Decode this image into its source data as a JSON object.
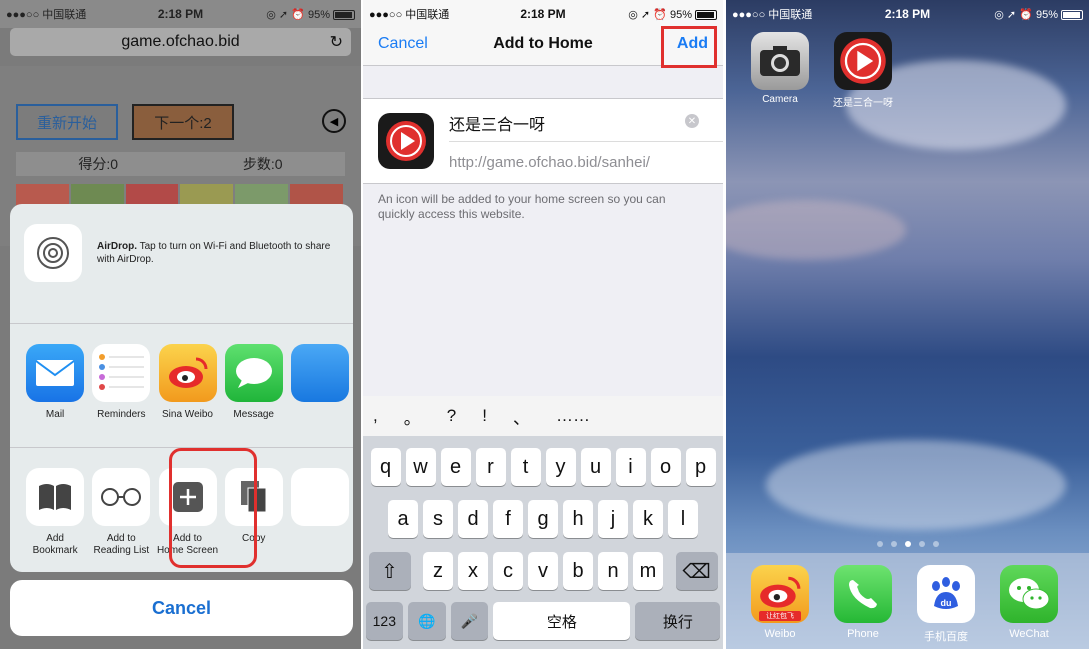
{
  "status_bar": {
    "carrier": "●●●○○ 中国联通",
    "time": "2:18 PM",
    "battery": "95%",
    "icons": "◎ ➚ ⏰"
  },
  "safari": {
    "url": "game.ofchao.bid",
    "reload_icon": "reload-icon",
    "game": {
      "restart_label": "重新开始",
      "next_label": "下一个:2",
      "score_label": "得分:0",
      "steps_label": "步数:0",
      "colors": [
        "#b85a4e",
        "#6e8a52",
        "#b24a48",
        "#9a9a52",
        "#7c9a6a",
        "#b05448"
      ]
    },
    "share_sheet": {
      "airdrop_title": "AirDrop.",
      "airdrop_text": "Tap to turn on Wi-Fi and Bluetooth to share with AirDrop.",
      "apps": [
        {
          "label": "Mail",
          "icon": "mail-icon",
          "color": "#1f8ff2"
        },
        {
          "label": "Reminders",
          "icon": "reminders-icon",
          "color": "#ffffff"
        },
        {
          "label": "Sina Weibo",
          "icon": "weibo-icon",
          "color": "#f5b52e"
        },
        {
          "label": "Message",
          "icon": "message-icon",
          "color": "#35c94a"
        }
      ],
      "actions": [
        {
          "label": "Add\nBookmark",
          "line1": "Add",
          "line2": "Bookmark",
          "icon": "book-icon"
        },
        {
          "label": "Add to Reading List",
          "line1": "Add to",
          "line2": "Reading List",
          "icon": "glasses-icon"
        },
        {
          "label": "Add to Home Screen",
          "line1": "Add to",
          "line2": "Home Screen",
          "icon": "plus-square-icon"
        },
        {
          "label": "Copy",
          "line1": "Copy",
          "line2": "",
          "icon": "copy-icon"
        }
      ],
      "cancel_label": "Cancel"
    }
  },
  "add_to_home": {
    "cancel_label": "Cancel",
    "title": "Add to Home",
    "add_label": "Add",
    "app_name": "还是三合一呀",
    "app_url": "http://game.ofchao.bid/sanhei/",
    "hint": "An icon will be added to your home screen so you can quickly access this website.",
    "punctuation": [
      ",",
      "。",
      "?",
      "!",
      "、",
      "……"
    ],
    "keyboard": {
      "row1": [
        "q",
        "w",
        "e",
        "r",
        "t",
        "y",
        "u",
        "i",
        "o",
        "p"
      ],
      "row2": [
        "a",
        "s",
        "d",
        "f",
        "g",
        "h",
        "j",
        "k",
        "l"
      ],
      "row3": [
        "z",
        "x",
        "c",
        "v",
        "b",
        "n",
        "m"
      ],
      "num_label": "123",
      "space_label": "空格",
      "return_label": "换行"
    }
  },
  "home_screen": {
    "apps": [
      {
        "label": "Camera",
        "icon": "camera-icon"
      },
      {
        "label": "还是三合一呀",
        "icon": "play-icon"
      }
    ],
    "dock": [
      {
        "label": "Weibo",
        "icon": "weibo-icon",
        "badge": "让红包飞"
      },
      {
        "label": "Phone",
        "icon": "phone-icon"
      },
      {
        "label": "手机百度",
        "icon": "baidu-icon"
      },
      {
        "label": "WeChat",
        "icon": "wechat-icon"
      }
    ],
    "page_count": 5,
    "current_page": 3
  }
}
